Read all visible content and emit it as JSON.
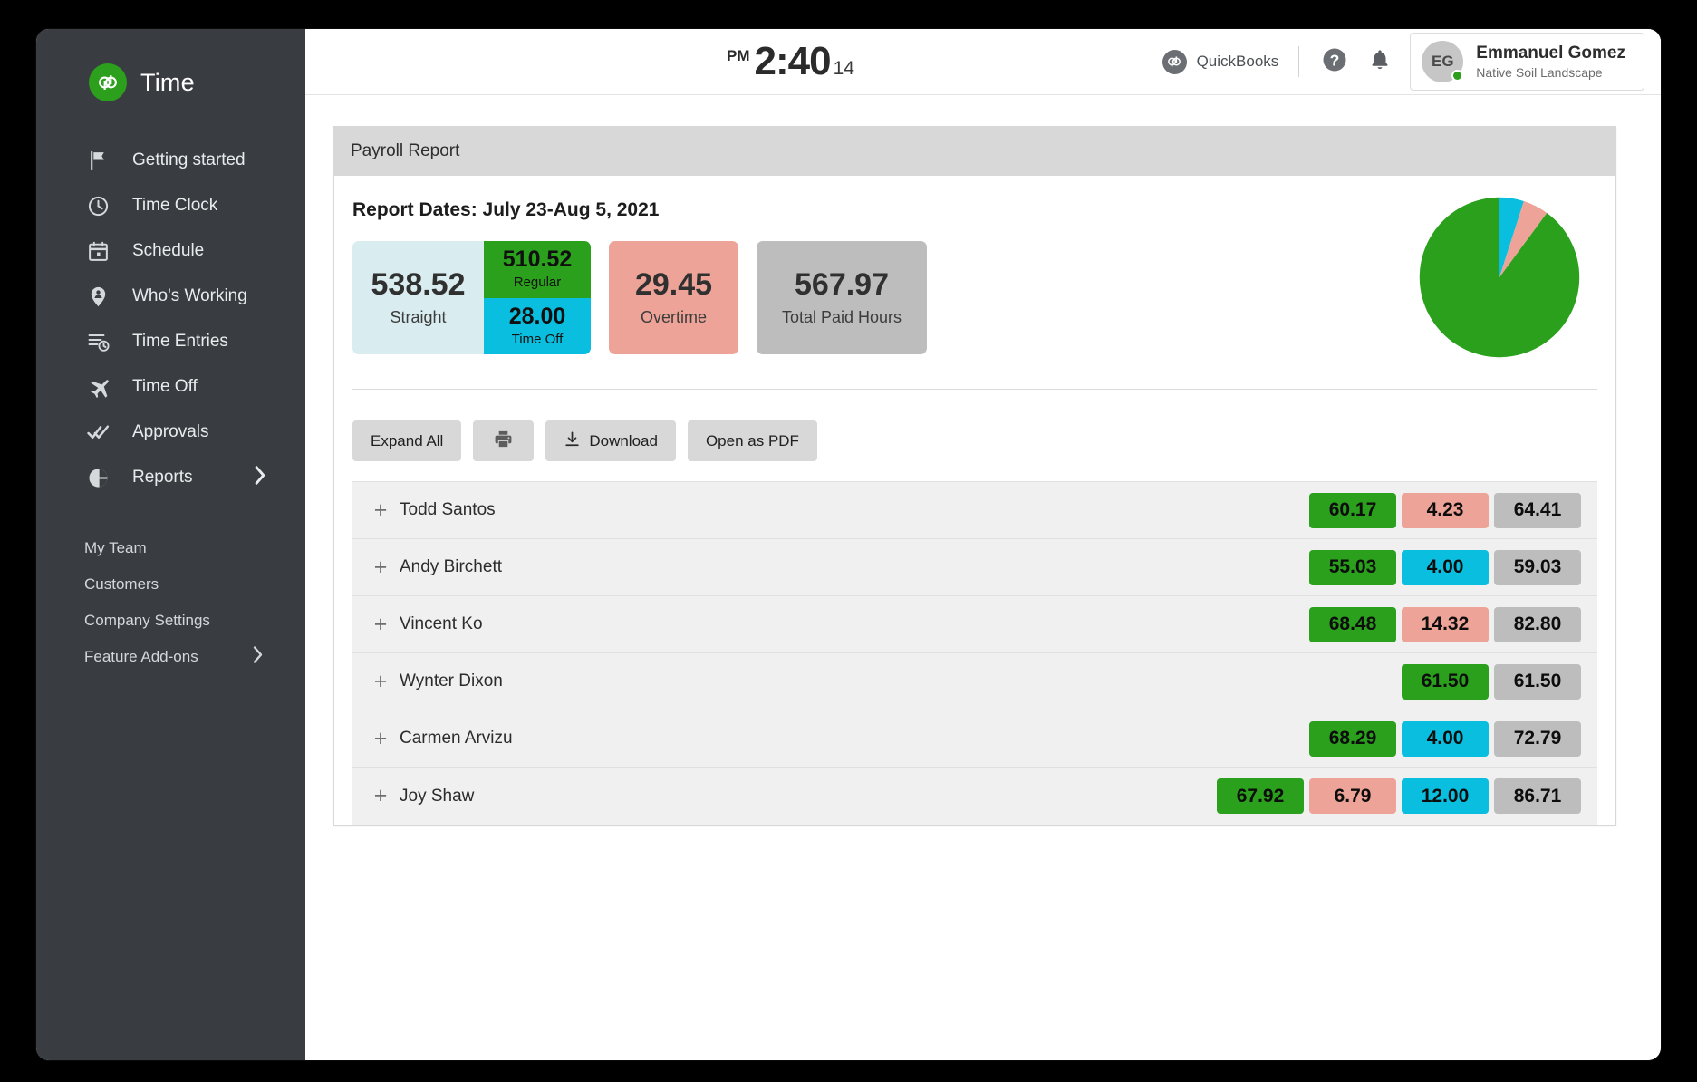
{
  "sidebar": {
    "brand": {
      "title": "Time",
      "logo_text": "qb"
    },
    "items": [
      {
        "label": "Getting started",
        "icon": "flag-icon",
        "chevron": false
      },
      {
        "label": "Time Clock",
        "icon": "clock-icon",
        "chevron": false
      },
      {
        "label": "Schedule",
        "icon": "calendar-icon",
        "chevron": false
      },
      {
        "label": "Who's Working",
        "icon": "map-pin-person-icon",
        "chevron": false
      },
      {
        "label": "Time Entries",
        "icon": "list-clock-icon",
        "chevron": false
      },
      {
        "label": "Time Off",
        "icon": "airplane-icon",
        "chevron": false
      },
      {
        "label": "Approvals",
        "icon": "double-check-icon",
        "chevron": false
      },
      {
        "label": "Reports",
        "icon": "pie-chart-icon",
        "chevron": true
      }
    ],
    "sub_items": [
      {
        "label": "My Team",
        "chevron": false
      },
      {
        "label": "Customers",
        "chevron": false
      },
      {
        "label": "Company Settings",
        "chevron": false
      },
      {
        "label": "Feature Add-ons",
        "chevron": true
      }
    ]
  },
  "topbar": {
    "clock": {
      "ampm": "PM",
      "time": "2:40",
      "seconds": "14"
    },
    "quickbooks_label": "QuickBooks",
    "quickbooks_logo_text": "qb",
    "help_icon": "question-mark-icon",
    "notification_icon": "bell-icon",
    "user": {
      "initials": "EG",
      "name": "Emmanuel Gomez",
      "org": "Native Soil Landscape",
      "status": "online"
    }
  },
  "report": {
    "card_title": "Payroll Report",
    "dates_label": "Report Dates: July 23-Aug 5, 2021",
    "summary": {
      "straight": {
        "value": "538.52",
        "label": "Straight"
      },
      "regular": {
        "value": "510.52",
        "label": "Regular"
      },
      "time_off": {
        "value": "28.00",
        "label": "Time Off"
      },
      "overtime": {
        "value": "29.45",
        "label": "Overtime"
      },
      "total": {
        "value": "567.97",
        "label": "Total Paid Hours"
      }
    },
    "buttons": [
      {
        "label": "Expand All",
        "icon": null
      },
      {
        "label": "",
        "icon": "printer-icon"
      },
      {
        "label": "Download",
        "icon": "download-icon"
      },
      {
        "label": "Open as PDF",
        "icon": null
      }
    ],
    "rows": [
      {
        "name": "Todd Santos",
        "expand": "+",
        "pills": [
          {
            "value": "60.17",
            "kind": "green"
          },
          {
            "value": "4.23",
            "kind": "pink"
          },
          {
            "value": "64.41",
            "kind": "grey"
          }
        ]
      },
      {
        "name": "Andy Birchett",
        "expand": "+",
        "pills": [
          {
            "value": "55.03",
            "kind": "green"
          },
          {
            "value": "4.00",
            "kind": "cyan"
          },
          {
            "value": "59.03",
            "kind": "grey"
          }
        ]
      },
      {
        "name": "Vincent Ko",
        "expand": "+",
        "pills": [
          {
            "value": "68.48",
            "kind": "green"
          },
          {
            "value": "14.32",
            "kind": "pink"
          },
          {
            "value": "82.80",
            "kind": "grey"
          }
        ]
      },
      {
        "name": "Wynter Dixon",
        "expand": "+",
        "pills": [
          {
            "value": "61.50",
            "kind": "green"
          },
          {
            "value": "61.50",
            "kind": "grey"
          }
        ]
      },
      {
        "name": "Carmen Arvizu",
        "expand": "+",
        "pills": [
          {
            "value": "68.29",
            "kind": "green"
          },
          {
            "value": "4.00",
            "kind": "cyan"
          },
          {
            "value": "72.79",
            "kind": "grey"
          }
        ]
      },
      {
        "name": "Joy Shaw",
        "expand": "+",
        "pills": [
          {
            "value": "67.92",
            "kind": "green"
          },
          {
            "value": "6.79",
            "kind": "pink"
          },
          {
            "value": "12.00",
            "kind": "cyan"
          },
          {
            "value": "86.71",
            "kind": "grey"
          }
        ]
      }
    ]
  },
  "chart_data": {
    "type": "pie",
    "title": "",
    "labels": [
      "Regular",
      "Overtime",
      "Time Off"
    ],
    "values": [
      510.52,
      29.45,
      28.0
    ],
    "colors": [
      "#2aa01c",
      "#eda397",
      "#09bede"
    ],
    "legend": "none",
    "total": 567.97
  },
  "colors": {
    "brand_green": "#2aa01c",
    "overtime_pink": "#eda397",
    "time_off_cyan": "#09bede",
    "total_grey": "#bdbdbd",
    "straight_blue": "#d9ecef",
    "sidebar_bg": "#393d41"
  }
}
